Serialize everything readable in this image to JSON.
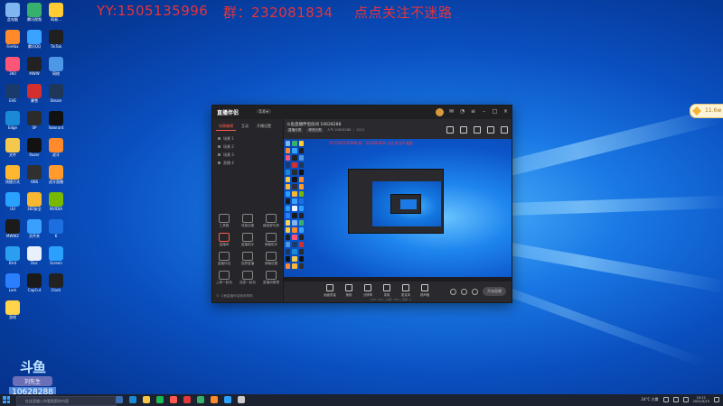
{
  "overlay": {
    "yy": "YY:1505135996",
    "group": "群：232081834",
    "follow": "点点关注不迷路"
  },
  "desktop_icons": [
    {
      "label": "此电脑",
      "color": "#7fb6f0"
    },
    {
      "label": "腾讯视频",
      "color": "#38b06d"
    },
    {
      "label": "网易...",
      "color": "#ffcc33"
    },
    {
      "label": "Firefox",
      "color": "#ff8a2b"
    },
    {
      "label": "腾讯QQ",
      "color": "#39a3ff"
    },
    {
      "label": "TikTok",
      "color": "#202020"
    },
    {
      "label": "360",
      "color": "#ff5576"
    },
    {
      "label": "MWW",
      "color": "#222222"
    },
    {
      "label": "网络",
      "color": "#4d98e6"
    },
    {
      "label": "EVE",
      "color": "#1a3a6b"
    },
    {
      "label": "暴雪",
      "color": "#d32f2f"
    },
    {
      "label": "Steam",
      "color": "#1e3758"
    },
    {
      "label": "Edge",
      "color": "#1a8ad6"
    },
    {
      "label": "SP",
      "color": "#2b2b2b"
    },
    {
      "label": "Valorant",
      "color": "#111111"
    },
    {
      "label": "文件",
      "color": "#f4c74d"
    },
    {
      "label": "Razer",
      "color": "#121212"
    },
    {
      "label": "虎牙",
      "color": "#ff8a2b"
    },
    {
      "label": "快捷方式",
      "color": "#ffb732"
    },
    {
      "label": "OBS",
      "color": "#303030"
    },
    {
      "label": "虎牙直播",
      "color": "#ff9a2b"
    },
    {
      "label": "UU",
      "color": "#2aa1ff"
    },
    {
      "label": "360安全",
      "color": "#f7b731"
    },
    {
      "label": "NVIDIA",
      "color": "#76b900"
    },
    {
      "label": "MWW2",
      "color": "#1b1b1b"
    },
    {
      "label": "文件夹",
      "color": "#3aa0ff"
    },
    {
      "label": "K",
      "color": "#1d6fe0"
    },
    {
      "label": "Bird",
      "color": "#2a9ff0"
    },
    {
      "label": "Doc",
      "color": "#e8f0fb"
    },
    {
      "label": "Screen",
      "color": "#2aa1ff"
    },
    {
      "label": "Lark",
      "color": "#2a7fff"
    },
    {
      "label": "CapCut",
      "color": "#1a1a1a"
    },
    {
      "label": "Clock",
      "color": "#222"
    },
    {
      "label": "游戏",
      "color": "#ffd34a"
    }
  ],
  "app": {
    "logo": "直播伴侣",
    "version": "5.0 ▾",
    "side_tabs": [
      "场景编辑",
      "互动",
      "开播设置"
    ],
    "scenes": [
      "场景 1",
      "场景 2",
      "场景 3",
      "直播 4"
    ],
    "tools": [
      [
        "工具箱",
        "快速创建",
        "横竖屏切换"
      ],
      [
        "直播间",
        "直播助手",
        "弹幕助手"
      ],
      [
        "直播伴侣",
        "投屏直播",
        "弹幕设置"
      ],
      [
        "上新一起玩",
        "连麦一起玩",
        "直播间管理"
      ]
    ],
    "sidebar_footer": "© 斗鱼直播伴侣使用帮助",
    "room_title": "斗鱼直播伴侣房间 10628288",
    "room_sub_tags": [
      "直播分类",
      "修改分类"
    ],
    "room_sub_stats": "人气 10628288 ｜ 1011",
    "overlay_preview_text": "YY:1505135996    群：232081834    点点关注不迷路",
    "bottom_tools": [
      "画面质量",
      "美颜",
      "分辨率",
      "录制",
      "麦克风",
      "扬声器"
    ],
    "start_label": "开始直播",
    "status_text": "CPU: 24% | 内存: 48% | 码率: 0"
  },
  "float_widget": {
    "text": "11.6w"
  },
  "live_logo": {
    "brand": "斗鱼",
    "name": "刘先生",
    "room": "10628288"
  },
  "taskbar": {
    "search_placeholder": "在这里输入你要搜索的内容",
    "weather": "24°C 大雾",
    "time": "19:12",
    "date": "2022/3/15"
  }
}
